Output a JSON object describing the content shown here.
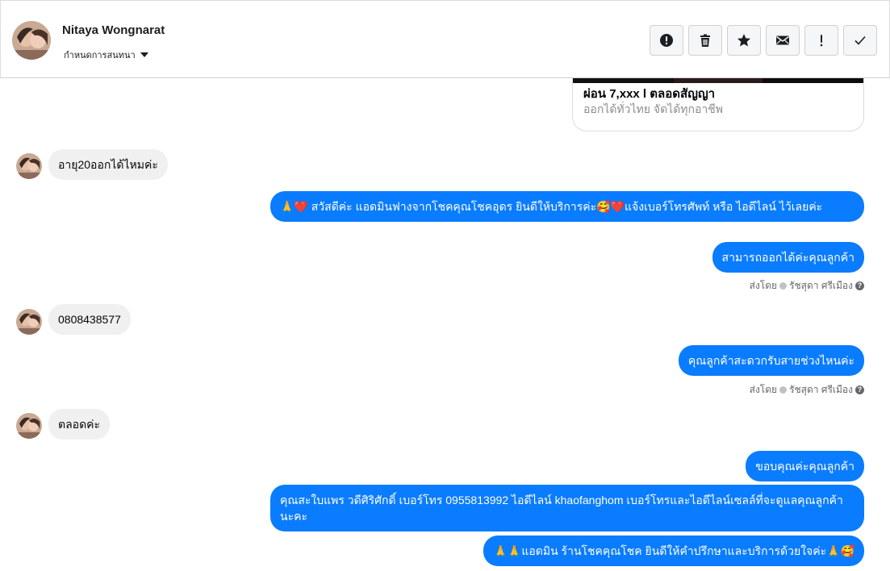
{
  "header": {
    "contact_name": "Nitaya Wongnarat",
    "assign_label": "กำหนดการสนทนา",
    "actions": [
      {
        "name": "mark-spam-button",
        "icon": "alert-circle-icon"
      },
      {
        "name": "delete-button",
        "icon": "trash-icon"
      },
      {
        "name": "star-button",
        "icon": "star-icon"
      },
      {
        "name": "mark-unread-button",
        "icon": "envelope-icon"
      },
      {
        "name": "follow-up-button",
        "icon": "exclamation-icon"
      },
      {
        "name": "mark-done-button",
        "icon": "check-icon"
      }
    ]
  },
  "card": {
    "title": "ผ่อน 7,xxx l ตลอดสัญญา",
    "subtitle": "ออกได้ทั่วไทย จัดได้ทุกอาชีพ"
  },
  "messages": [
    {
      "dir": "in",
      "text": "อายุ20ออกได้ไหมค่ะ"
    },
    {
      "dir": "out",
      "text": "🙏❤️ สวัสดีค่ะ แอดมินฟางจากโชคคุณโชคอุดร ยินดีให้บริการค่ะ🥰❤️แจ้งเบอร์โทรศัพท์ หรือ ไอดีไลน์  ไว้เลยค่ะ"
    },
    {
      "dir": "out",
      "text": "สามารถออกได้ค่ะคุณลูกค้า"
    },
    {
      "dir": "in",
      "text": "0808438577"
    },
    {
      "dir": "out",
      "text": "คุณลูกค้าสะดวกรับสายช่วงไหนค่ะ"
    },
    {
      "dir": "in",
      "text": "ตลอดค่ะ"
    },
    {
      "dir": "out",
      "text": "ขอบคุณค่ะคุณลูกค้า"
    },
    {
      "dir": "out",
      "text": "คุณสะใบแพร วดีศิริศักดิ์ เบอร์โทร 0955813992  ไอดีไลน์  khaofanghom  เบอร์โทรและไอดีไลน์เซลล์ที่จะดูแลคุณลูกค้านะคะ"
    },
    {
      "dir": "out",
      "text": "🙏🙏แอดมิน ร้านโชคคุณโชค ยินดีให้คำปรึกษาและบริการด้วยใจค่ะ🙏🥰"
    }
  ],
  "sent_by": {
    "prefix": "ส่งโดย",
    "agent": "รัชสุดา ศรีเมือง",
    "help_glyph": "?"
  },
  "colors": {
    "outgoing_bubble": "#0a7cff",
    "incoming_bubble": "#f0f0f0"
  }
}
